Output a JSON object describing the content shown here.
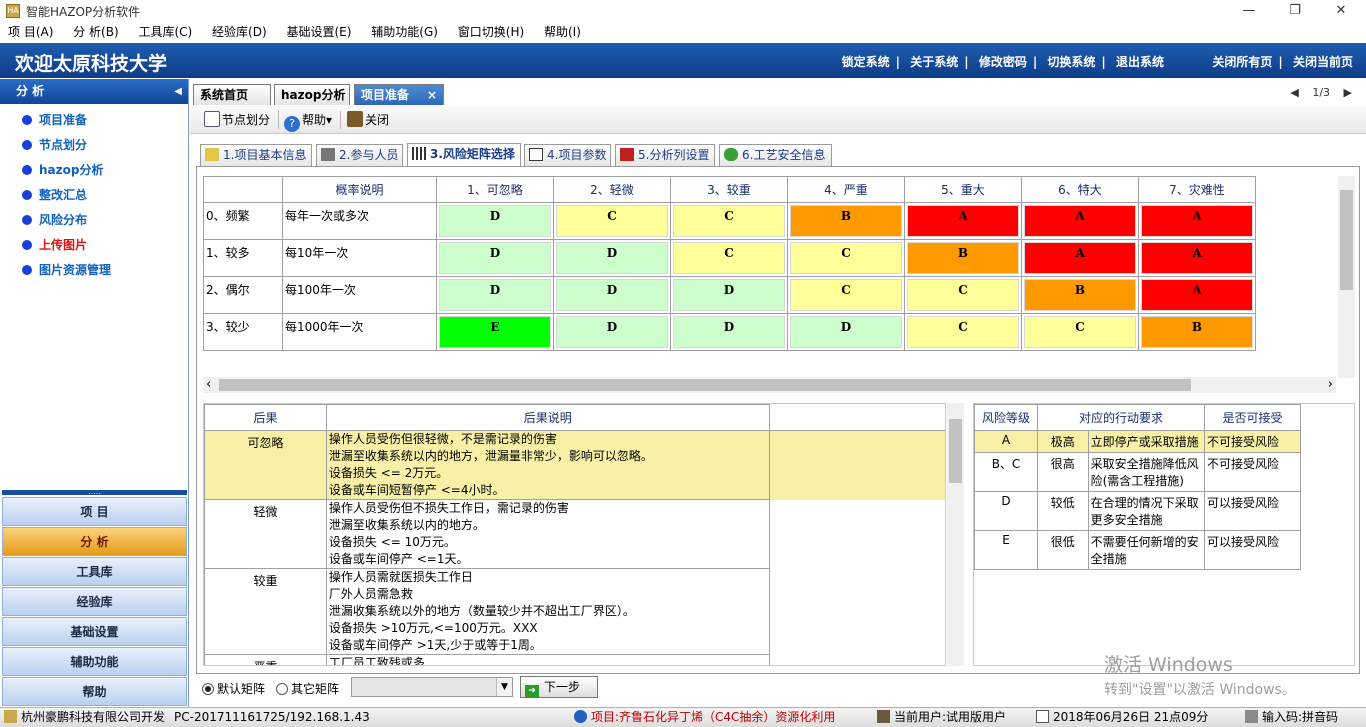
{
  "window": {
    "title": "智能HAZOP分析软件",
    "icon_text": "HA",
    "min": "—",
    "max": "❐",
    "close": "✕"
  },
  "menu": [
    "项 目(A)",
    "分 析(B)",
    "工具库(C)",
    "经验库(D)",
    "基础设置(E)",
    "辅助功能(G)",
    "窗口切换(H)",
    "帮助(I)"
  ],
  "header": {
    "welcome": "欢迎太原科技大学",
    "links": [
      "锁定系统",
      "关于系统",
      "修改密码",
      "切换系统",
      "退出系统"
    ],
    "separator": "|",
    "right_links": [
      "关闭所有页",
      "关闭当前页"
    ]
  },
  "sidebar": {
    "title": "分 析",
    "collapse_arrow": "◀",
    "items": [
      {
        "label": "项目准备",
        "color": "#1060c0"
      },
      {
        "label": "节点划分",
        "color": "#1060c0"
      },
      {
        "label": "hazop分析",
        "color": "#1060c0"
      },
      {
        "label": "整改汇总",
        "color": "#1060c0"
      },
      {
        "label": "风险分布",
        "color": "#1060c0"
      },
      {
        "label": "上传图片",
        "color": "#e01010"
      },
      {
        "label": "图片资源管理",
        "color": "#1060c0"
      }
    ],
    "nav": [
      "项 目",
      "分 析",
      "工具库",
      "经验库",
      "基础设置",
      "辅助功能",
      "帮助"
    ],
    "active_nav": "分 析",
    "splitter": "....."
  },
  "tabs": {
    "items": [
      "系统首页",
      "hazop分析",
      "项目准备"
    ],
    "active": "项目准备",
    "close": "×",
    "pager": "1/3",
    "prev": "◀",
    "next": "▶"
  },
  "toolbar": {
    "node_split": "节点划分",
    "help": "帮助",
    "help_arrow": "▾",
    "close": "关闭"
  },
  "subtabs": {
    "items": [
      "1.项目基本信息",
      "2.参与人员",
      "3.风险矩阵选择",
      "4.项目参数",
      "5.分析列设置",
      "6.工艺安全信息"
    ],
    "active": "3.风险矩阵选择"
  },
  "matrix": {
    "header_blank": "",
    "prob_header": "概率说明",
    "severity": [
      "1、可忽略",
      "2、轻微",
      "3、较重",
      "4、严重",
      "5、重大",
      "6、特大",
      "7、灾难性"
    ],
    "rows": [
      {
        "freq": "0、频繁",
        "desc": "每年一次或多次",
        "cells": [
          "D",
          "C",
          "C",
          "B",
          "A",
          "A",
          "A"
        ]
      },
      {
        "freq": "1、较多",
        "desc": "每10年一次",
        "cells": [
          "D",
          "D",
          "C",
          "C",
          "B",
          "A",
          "A"
        ]
      },
      {
        "freq": "2、偶尔",
        "desc": "每100年一次",
        "cells": [
          "D",
          "D",
          "D",
          "C",
          "C",
          "B",
          "A"
        ]
      },
      {
        "freq": "3、较少",
        "desc": "每1000年一次",
        "cells": [
          "E",
          "D",
          "D",
          "D",
          "C",
          "C",
          "B"
        ]
      }
    ],
    "colors": {
      "A": "#ff0000",
      "B": "#ff9900",
      "C": "#ffff99",
      "D": "#ccffcc",
      "E": "#00ff00"
    },
    "scroll_left": "‹",
    "scroll_right": "›"
  },
  "consequence": {
    "headers": [
      "后果",
      "后果说明"
    ],
    "rows": [
      {
        "label": "可忽略",
        "lines": [
          "操作人员受伤但很轻微，不是需记录的伤害",
          "泄漏至收集系统以内的地方，泄漏量非常少，影响可以忽略。",
          "设备损失 <= 2万元。",
          "设备或车间短暂停产 <=4小时。"
        ]
      },
      {
        "label": "轻微",
        "lines": [
          "操作人员受伤但不损失工作日，需记录的伤害",
          "泄漏至收集系统以内的地方。",
          "设备损失 <= 10万元。",
          "设备或车间停产 <=1天。"
        ]
      },
      {
        "label": "较重",
        "lines": [
          "操作人员需就医损失工作日",
          "厂外人员需急救",
          "泄漏收集系统以外的地方（数量较少并不超出工厂界区）。",
          "设备损失 >10万元,<=100万元。XXX",
          "设备或车间停产 >1天,少于或等于1周。"
        ]
      },
      {
        "label": "严重",
        "lines": [
          "工厂员工致残或多"
        ]
      }
    ]
  },
  "action": {
    "headers": [
      "风险等级",
      "对应的行动要求",
      "是否可接受"
    ],
    "rows": [
      {
        "level": "A",
        "degree": "极高",
        "req": "立即停产或采取措施",
        "ok": "不可接受风险"
      },
      {
        "level": "B、C",
        "degree": "很高",
        "req": "采取安全措施降低风险(需含工程措施)",
        "ok": "不可接受风险"
      },
      {
        "level": "D",
        "degree": "较低",
        "req": "在合理的情况下采取更多安全措施",
        "ok": "可以接受风险"
      },
      {
        "level": "E",
        "degree": "很低",
        "req": "不需要任何新增的安全措施",
        "ok": "可以接受风险"
      }
    ]
  },
  "bottom": {
    "radio1": "默认矩阵",
    "radio2": "其它矩阵",
    "combo_value": "",
    "combo_arrow": "▼",
    "next": "下一步",
    "next_icon": "➜"
  },
  "watermark": {
    "line1": "激活 Windows",
    "line2": "转到\"设置\"以激活 Windows。"
  },
  "status": {
    "company": "杭州豪鹏科技有限公司开发",
    "host": "PC-201711161725/192.168.1.43",
    "project": "项目:齐鲁石化异丁烯（C4C抽余）资源化利用",
    "user": "当前用户:试用版用户",
    "datetime": "2018年06月26日 21点09分",
    "ime": "输入码:拼音码"
  }
}
